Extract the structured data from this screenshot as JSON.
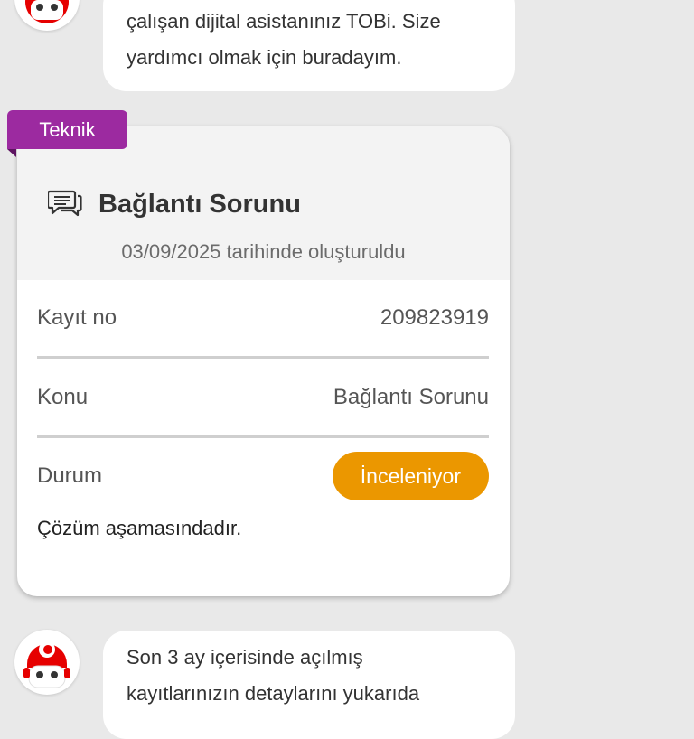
{
  "colors": {
    "background": "#e9e9e9",
    "tag_purple": "#9c2aa0",
    "status_orange": "#eb9700",
    "brand_red": "#e60000"
  },
  "top_message": {
    "line1": "çalışan dijital asistanınız TOBi. Size",
    "line2": "yardımcı olmak için buradayım."
  },
  "ticket": {
    "category_tag": "Teknik",
    "icon": "chat-bubbles-icon",
    "title": "Bağlantı Sorunu",
    "created": "03/09/2025 tarihinde oluşturuldu",
    "record_label": "Kayıt no",
    "record_value": "209823919",
    "subject_label": "Konu",
    "subject_value": "Bağlantı Sorunu",
    "status_label": "Durum",
    "status_value": "İnceleniyor",
    "status_description": "Çözüm aşamasındadır."
  },
  "bottom_message": {
    "line1": "Son 3 ay içerisinde açılmış",
    "line2": "kayıtlarınızın detaylarını yukarıda"
  },
  "avatar_icon": "tobi-robot-avatar-icon"
}
